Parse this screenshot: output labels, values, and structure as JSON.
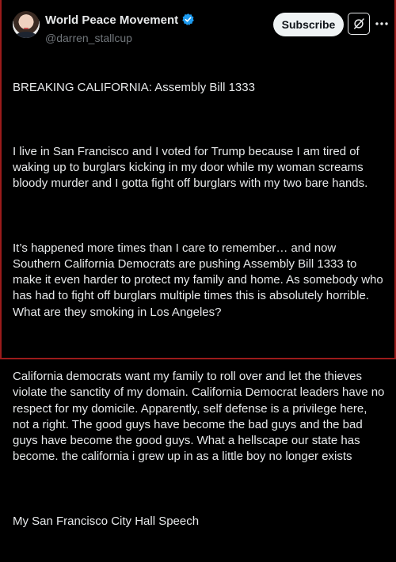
{
  "author": {
    "display_name": "World Peace Movement",
    "handle": "@darren_stallcup",
    "verified_icon": "verified-badge-icon",
    "verified_color": "#1d9bf0"
  },
  "actions": {
    "subscribe_label": "Subscribe",
    "grok_icon": "grok-icon",
    "more_icon": "more-options-icon"
  },
  "post": {
    "paragraphs": [
      "BREAKING CALIFORNIA: Assembly Bill 1333",
      "I live in San Francisco and I voted for Trump because I am tired of waking up to burglars kicking in my door while my woman screams bloody murder and I gotta fight off burglars with my two bare hands.",
      "It’s happened more times than I care to remember… and now Southern California Democrats are pushing Assembly Bill 1333 to make it even harder to protect my family and home. As somebody who has had to fight off burglars multiple times this is absolutely horrible. What are they smoking in Los Angeles?",
      "California democrats want my family to roll over and let the thieves violate the sanctity of my domain. California Democrat leaders have no respect for my domicile. Apparently, self defense is a privilege here, not a right. The good guys have become the bad guys and the bad guys have become the good guys. What a hellscape our state has become. the california i grew up in as a little boy no longer exists",
      "My San Francisco City Hall Speech"
    ]
  }
}
